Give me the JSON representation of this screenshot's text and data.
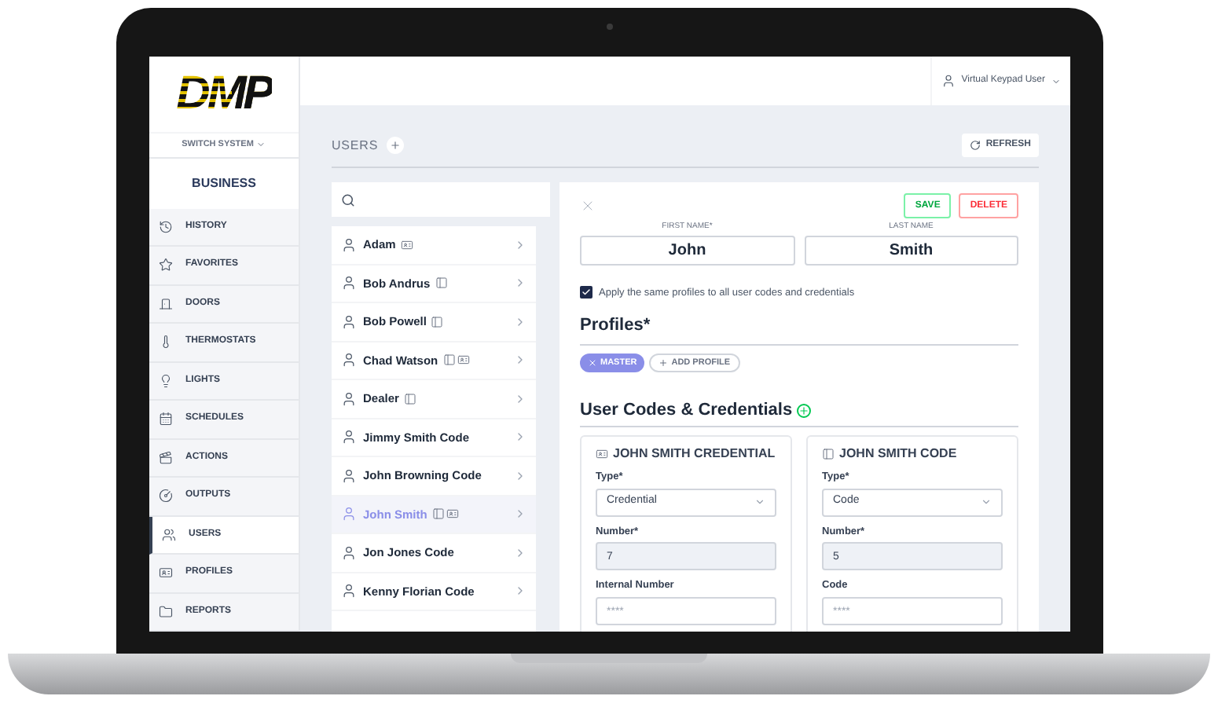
{
  "logo": {
    "text": "DMP"
  },
  "sidebar": {
    "system_switcher": "SWITCH SYSTEM",
    "system_name": "BUSINESS",
    "items": [
      {
        "label": "HISTORY",
        "selected": false
      },
      {
        "label": "FAVORITES",
        "selected": false
      },
      {
        "label": "DOORS",
        "selected": false
      },
      {
        "label": "THERMOSTATS",
        "selected": false
      },
      {
        "label": "LIGHTS",
        "selected": false
      },
      {
        "label": "SCHEDULES",
        "selected": false
      },
      {
        "label": "ACTIONS",
        "selected": false
      },
      {
        "label": "OUTPUTS",
        "selected": false
      },
      {
        "label": "USERS",
        "selected": true
      },
      {
        "label": "PROFILES",
        "selected": false
      },
      {
        "label": "REPORTS",
        "selected": false
      }
    ]
  },
  "header": {
    "user_menu": "Virtual Keypad User"
  },
  "page": {
    "title": "USERS",
    "refresh_button": "REFRESH"
  },
  "users": [
    {
      "name": "Adam",
      "selected": false,
      "badges": [
        {
          "kind": "credential"
        }
      ]
    },
    {
      "name": "Bob Andrus",
      "selected": false,
      "badges": [
        {
          "kind": "code"
        }
      ]
    },
    {
      "name": "Bob Powell",
      "selected": false,
      "badges": [
        {
          "kind": "code"
        }
      ]
    },
    {
      "name": "Chad Watson",
      "selected": false,
      "badges": [
        {
          "kind": "code"
        },
        {
          "kind": "credential"
        }
      ]
    },
    {
      "name": "Dealer",
      "selected": false,
      "badges": [
        {
          "kind": "code"
        }
      ]
    },
    {
      "name": "Jimmy Smith Code",
      "selected": false
    },
    {
      "name": "John Browning Code",
      "selected": false
    },
    {
      "name": "John Smith",
      "selected": true,
      "badges": [
        {
          "kind": "code"
        },
        {
          "kind": "credential"
        }
      ]
    },
    {
      "name": "Jon Jones Code",
      "selected": false
    },
    {
      "name": "Kenny Florian Code",
      "selected": false
    }
  ],
  "detail": {
    "save_button": "SAVE",
    "delete_button": "DELETE",
    "first_name": {
      "label": "FIRST NAME*",
      "value": "John"
    },
    "last_name": {
      "label": "LAST NAME",
      "value": "Smith"
    },
    "apply_profiles": {
      "label": "Apply the same profiles to all user codes and credentials",
      "checked": true
    },
    "profiles_heading": "Profiles*",
    "profiles": [
      {
        "name": "MASTER"
      }
    ],
    "add_profile_button": "ADD PROFILE",
    "codes_heading": "User Codes & Credentials",
    "cards": [
      {
        "kind": "credential",
        "title": "JOHN SMITH CREDENTIAL",
        "fields": [
          {
            "kind": "select",
            "label": "Type*",
            "value": "Credential"
          },
          {
            "kind": "input",
            "label": "Number*",
            "value": "7",
            "disabled": true
          },
          {
            "kind": "input",
            "label": "Internal Number",
            "placeholder": "****",
            "disabled": false
          }
        ]
      },
      {
        "kind": "code",
        "title": "JOHN SMITH CODE",
        "fields": [
          {
            "kind": "select",
            "label": "Type*",
            "value": "Code"
          },
          {
            "kind": "input",
            "label": "Number*",
            "value": "5",
            "disabled": true
          },
          {
            "kind": "input",
            "label": "Code",
            "placeholder": "****",
            "disabled": false
          }
        ]
      }
    ]
  }
}
